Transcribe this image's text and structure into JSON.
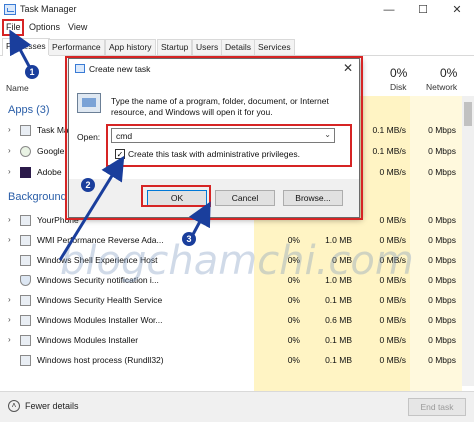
{
  "window": {
    "title": "Task Manager",
    "minimize": "—",
    "maximize": "☐",
    "close": "✕"
  },
  "menu": [
    "File",
    "Options",
    "View"
  ],
  "tabs": [
    "Processes",
    "Performance",
    "App history",
    "Startup",
    "Users",
    "Details",
    "Services"
  ],
  "columns": {
    "name": "Name",
    "disk_pct": "0%",
    "disk_label": "Disk",
    "network_pct": "0%",
    "network_label": "Network"
  },
  "sections": {
    "apps": "Apps (3)",
    "background": "Background"
  },
  "apps": [
    {
      "name": "Task Man",
      "disk": "0.1 MB/s",
      "network": "0 Mbps"
    },
    {
      "name": "Google",
      "disk": "0.1 MB/s",
      "network": "0 Mbps"
    },
    {
      "name": "Adobe",
      "disk": "0 MB/s",
      "network": "0 Mbps"
    }
  ],
  "background": [
    {
      "name": "YourPhone",
      "cpu": "",
      "mem": "",
      "disk": "0 MB/s",
      "network": "0 Mbps"
    },
    {
      "name": "WMI Performance Reverse Ada...",
      "cpu": "0%",
      "mem": "1.0 MB",
      "disk": "0 MB/s",
      "network": "0 Mbps"
    },
    {
      "name": "Windows Shell Experience Host",
      "cpu": "0%",
      "mem": "0 MB",
      "disk": "0 MB/s",
      "network": "0 Mbps"
    },
    {
      "name": "Windows Security notification i...",
      "cpu": "0%",
      "mem": "1.0 MB",
      "disk": "0 MB/s",
      "network": "0 Mbps"
    },
    {
      "name": "Windows Security Health Service",
      "cpu": "0%",
      "mem": "0.1 MB",
      "disk": "0 MB/s",
      "network": "0 Mbps"
    },
    {
      "name": "Windows Modules Installer Wor...",
      "cpu": "0%",
      "mem": "0.6 MB",
      "disk": "0 MB/s",
      "network": "0 Mbps"
    },
    {
      "name": "Windows Modules Installer",
      "cpu": "0%",
      "mem": "0.1 MB",
      "disk": "0 MB/s",
      "network": "0 Mbps"
    },
    {
      "name": "Windows host process (Rundll32)",
      "cpu": "0%",
      "mem": "0.1 MB",
      "disk": "0 MB/s",
      "network": "0 Mbps"
    }
  ],
  "footer": {
    "fewer_details": "Fewer details",
    "end_task": "End task"
  },
  "dialog": {
    "title": "Create new task",
    "close": "✕",
    "description": "Type the name of a program, folder, document, or Internet resource, and Windows will open it for you.",
    "open_label": "Open:",
    "open_value": "cmd",
    "admin_checkbox_label": "Create this task with administrative privileges.",
    "admin_checked": true,
    "check_mark": "✓",
    "ok": "OK",
    "cancel": "Cancel",
    "browse": "Browse..."
  },
  "annotations": {
    "badge1": "1",
    "badge2": "2",
    "badge3": "3",
    "watermark": "blogchamchi.com",
    "highlight_color": "#d62424",
    "arrow_color": "#1a3e9c"
  }
}
